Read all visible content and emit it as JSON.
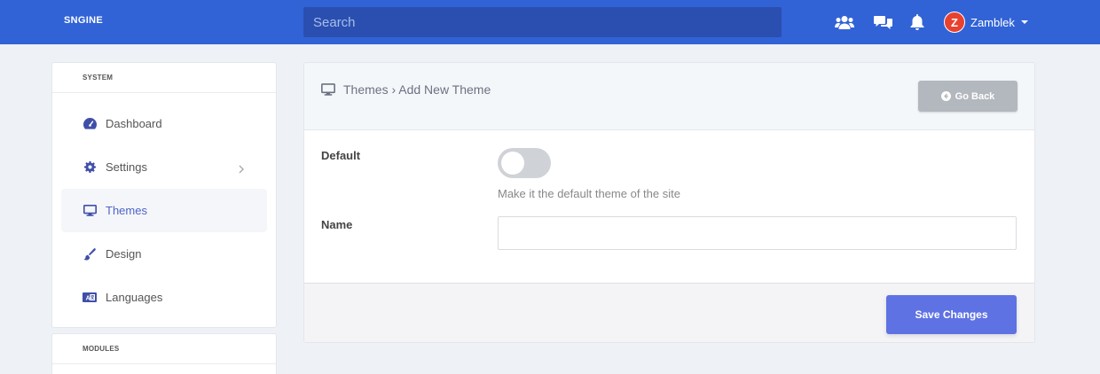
{
  "topbar": {
    "logo": "SNGINE",
    "search_placeholder": "Search",
    "icons": [
      "friends-icon",
      "messages-icon",
      "notifications-icon"
    ],
    "user": {
      "avatar_letter": "Z",
      "name": "Zamblek"
    }
  },
  "sidebar": {
    "system_header": "SYSTEM",
    "items": [
      {
        "label": "Dashboard",
        "icon": "dashboard-icon"
      },
      {
        "label": "Settings",
        "icon": "gear-icon"
      },
      {
        "label": "Themes",
        "icon": "monitor-icon",
        "active": true
      },
      {
        "label": "Design",
        "icon": "brush-icon"
      },
      {
        "label": "Languages",
        "icon": "language-icon"
      }
    ],
    "modules_header": "MODULES"
  },
  "main": {
    "breadcrumb": "Themes › Add New Theme",
    "go_back": "Go Back",
    "default_label": "Default",
    "default_help": "Make it the default theme of the site",
    "default_on": false,
    "name_label": "Name",
    "name_value": "",
    "save": "Save Changes"
  },
  "colors": {
    "topbar": "#3163d6",
    "search": "#2a4fb0",
    "accent": "#5e72e4",
    "active_item": "#5064c8",
    "go_back": "#b3b8be"
  }
}
